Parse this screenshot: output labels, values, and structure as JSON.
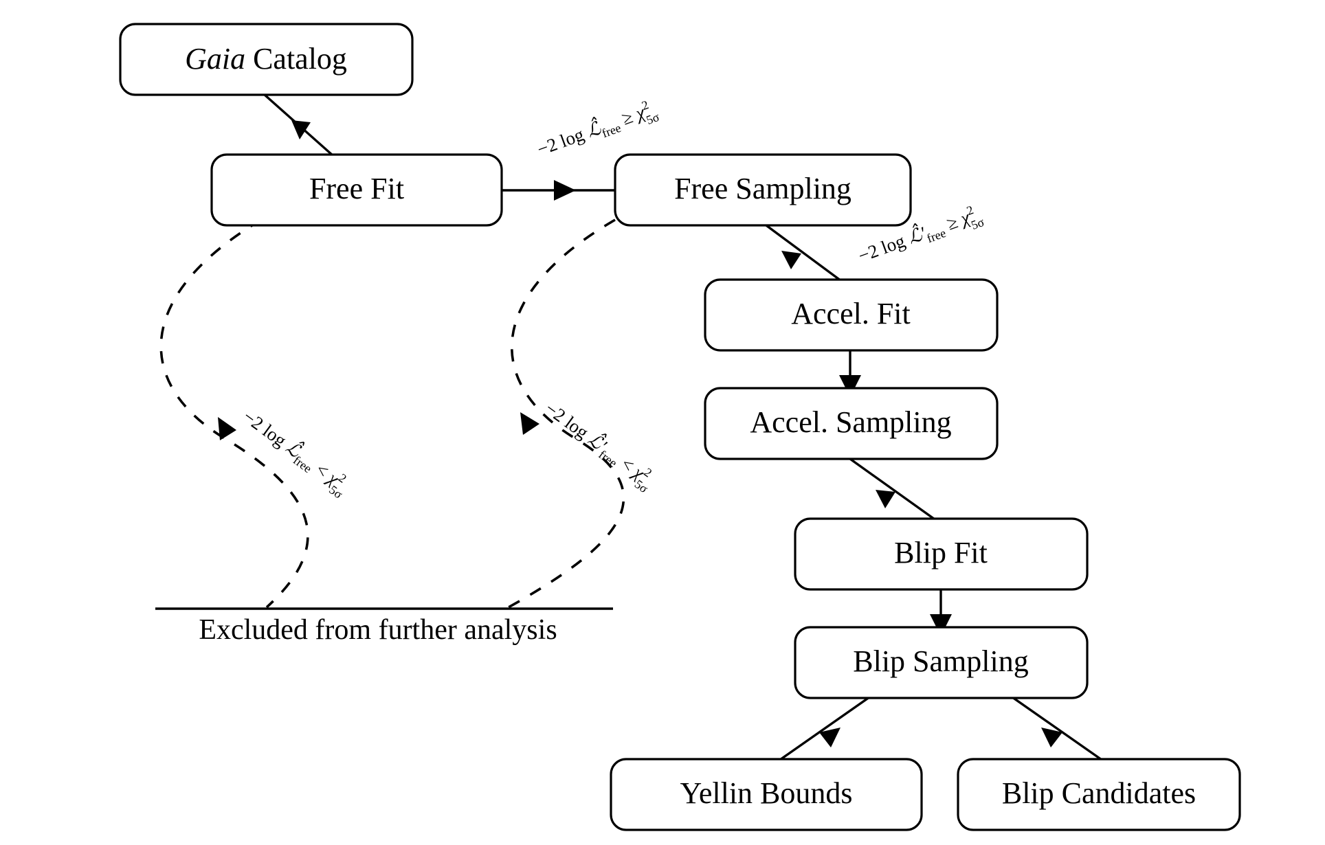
{
  "diagram": {
    "title": "Gaia blip search analysis pipeline flowchart",
    "background_color": "#ffffff",
    "line_color": "#000000",
    "nodes": [
      {
        "id": "gaia_catalog",
        "label": "Gaia Catalog",
        "emphasis_word": "Gaia",
        "shape": "rounded-rect"
      },
      {
        "id": "free_fit",
        "label": "Free Fit",
        "shape": "rounded-rect"
      },
      {
        "id": "free_sampling",
        "label": "Free Sampling",
        "shape": "rounded-rect"
      },
      {
        "id": "accel_fit",
        "label": "Accel. Fit",
        "shape": "rounded-rect"
      },
      {
        "id": "accel_sampling",
        "label": "Accel. Sampling",
        "shape": "rounded-rect"
      },
      {
        "id": "blip_fit",
        "label": "Blip Fit",
        "shape": "rounded-rect"
      },
      {
        "id": "blip_sampling",
        "label": "Blip Sampling",
        "shape": "rounded-rect"
      },
      {
        "id": "yellin_bounds",
        "label": "Yellin Bounds",
        "shape": "rounded-rect"
      },
      {
        "id": "blip_candidates",
        "label": "Blip Candidates",
        "shape": "rounded-rect"
      }
    ],
    "excluded_sink": {
      "label": "Excluded from further analysis"
    },
    "edges": [
      {
        "id": "e1",
        "from": "gaia_catalog",
        "to": "free_fit",
        "style": "solid",
        "label": ""
      },
      {
        "id": "e2",
        "from": "free_fit",
        "to": "free_sampling",
        "style": "solid",
        "label_parts": [
          "−2 log ",
          "L̂",
          "free",
          " ≥ ",
          "χ",
          "2",
          "5σ"
        ]
      },
      {
        "id": "e3",
        "from": "free_sampling",
        "to": "accel_fit",
        "style": "solid",
        "label_parts": [
          "−2 log ",
          "L̂′",
          "free",
          " ≥ ",
          "χ",
          "2",
          "5σ"
        ]
      },
      {
        "id": "e4",
        "from": "accel_fit",
        "to": "accel_sampling",
        "style": "solid",
        "label": ""
      },
      {
        "id": "e5",
        "from": "accel_sampling",
        "to": "blip_fit",
        "style": "solid",
        "label": ""
      },
      {
        "id": "e6",
        "from": "blip_fit",
        "to": "blip_sampling",
        "style": "solid",
        "label": ""
      },
      {
        "id": "e7",
        "from": "blip_sampling",
        "to": "yellin_bounds",
        "style": "solid",
        "label": ""
      },
      {
        "id": "e8",
        "from": "blip_sampling",
        "to": "blip_candidates",
        "style": "solid",
        "label": ""
      },
      {
        "id": "e9",
        "from": "free_fit",
        "to": "excluded_sink",
        "style": "dashed",
        "label_parts": [
          "−2 log ",
          "L̂",
          "free",
          " < ",
          "χ",
          "2",
          "5σ"
        ]
      },
      {
        "id": "e10",
        "from": "free_sampling",
        "to": "excluded_sink",
        "style": "dashed",
        "label_parts": [
          "−2 log ",
          "L̂′",
          "free",
          " < ",
          "χ",
          "2",
          "5σ"
        ]
      }
    ],
    "edge_labels": {
      "free_fit_pass": {
        "lead": "−2 log ",
        "script": "ℒ̂",
        "sub": "free",
        "rel": " ≥ ",
        "chi": "χ",
        "chi_sup": "2",
        "chi_sub": "5σ"
      },
      "free_sampling_pass": {
        "lead": "−2 log ",
        "script": "ℒ̂′",
        "sub": "free",
        "rel": " ≥ ",
        "chi": "χ",
        "chi_sup": "2",
        "chi_sub": "5σ"
      },
      "free_fit_fail": {
        "lead": "−2 log ",
        "script": "ℒ̂",
        "sub": "free",
        "rel": " < ",
        "chi": "χ",
        "chi_sup": "2",
        "chi_sub": "5σ"
      },
      "free_sampling_fail": {
        "lead": "−2 log ",
        "script": "ℒ̂′",
        "sub": "free",
        "rel": " < ",
        "chi": "χ",
        "chi_sup": "2",
        "chi_sub": "5σ"
      }
    }
  }
}
